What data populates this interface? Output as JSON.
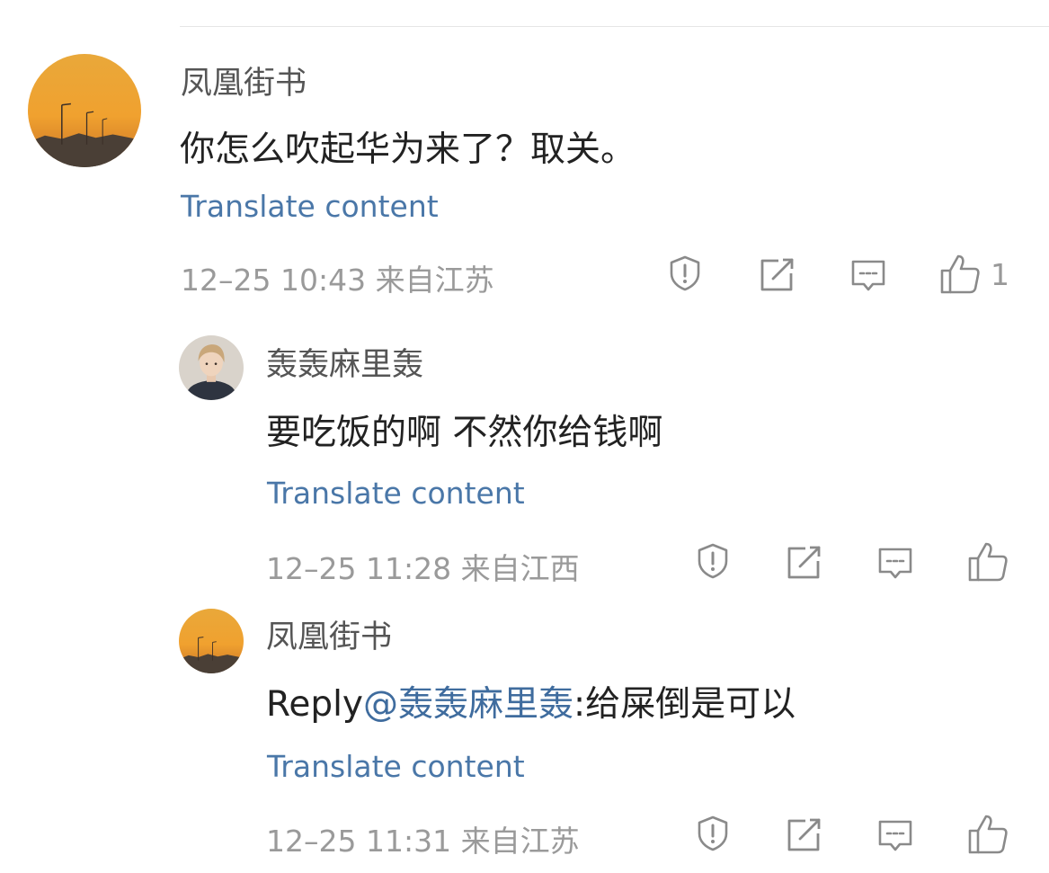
{
  "comments": [
    {
      "username": "凤凰街书",
      "content": "你怎么吹起华为来了？取关。",
      "translate": "Translate content",
      "meta": "12–25 10:43  来自江苏",
      "like_count": "1",
      "avatar": "sunset-avatar"
    },
    {
      "username": "轰轰麻里轰",
      "content": "要吃饭的啊 不然你给钱啊",
      "translate": "Translate content",
      "meta": "12–25 11:28  来自江西",
      "like_count": "",
      "avatar": "person-avatar"
    },
    {
      "username": "凤凰街书",
      "reply_prefix": "Reply",
      "mention": "@轰轰麻里轰",
      "content_after_mention": ":给屎倒是可以",
      "translate": "Translate content",
      "meta": "12–25 11:31  来自江苏",
      "like_count": "",
      "avatar": "sunset-avatar"
    }
  ],
  "icons": {
    "report": "report-icon",
    "share": "share-icon",
    "reply": "comment-icon",
    "like": "thumbs-up-icon"
  },
  "colors": {
    "link": "#4a77a8",
    "mention": "#3f6c9e",
    "meta": "#9a9a9a",
    "icon": "#8a8a8a"
  }
}
